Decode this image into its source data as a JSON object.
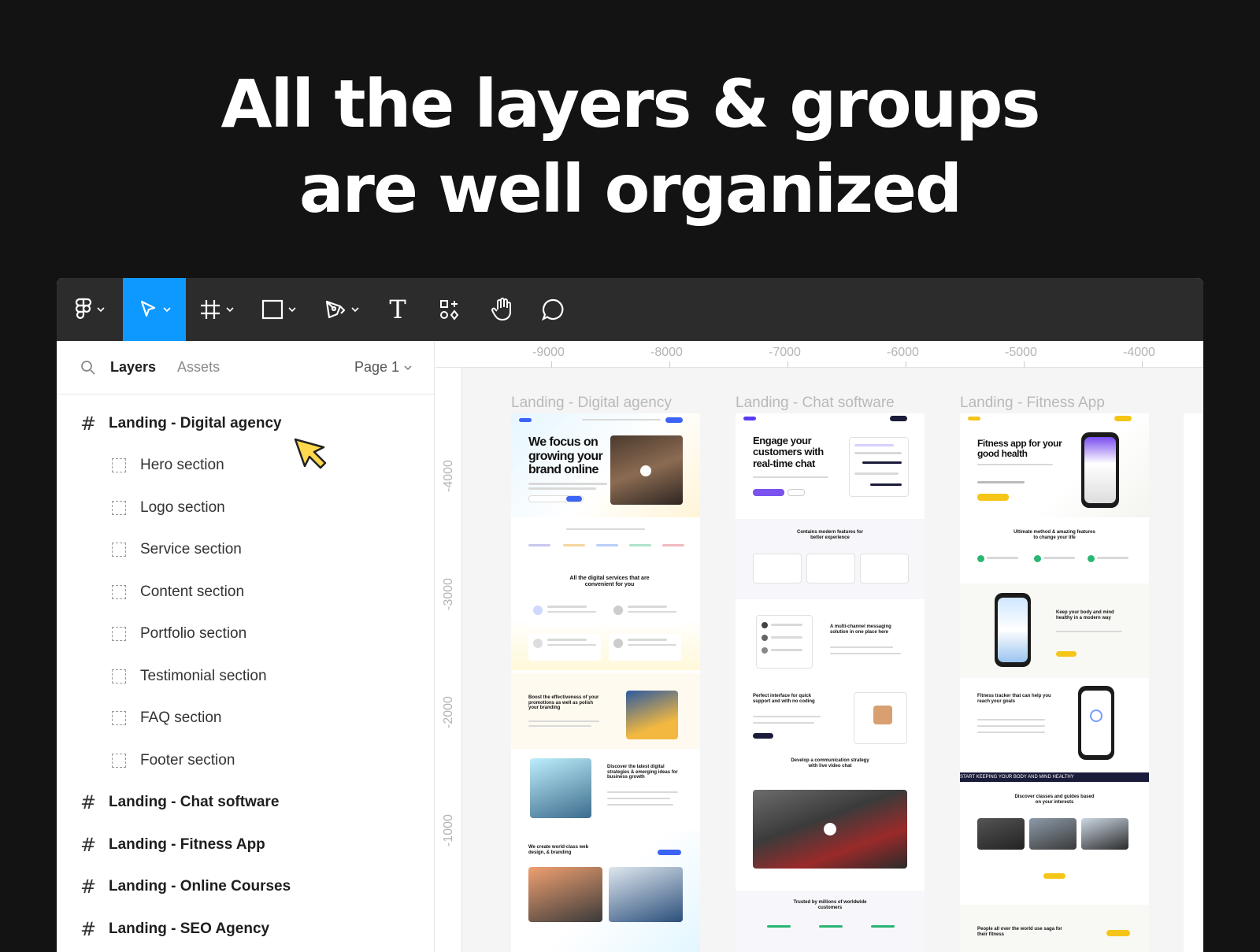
{
  "headline": {
    "line1": "All the layers & groups",
    "line2": "are well organized"
  },
  "toolbar": {
    "tools": [
      "main-menu",
      "move",
      "frame",
      "shape",
      "pen",
      "text",
      "resources",
      "hand",
      "comment"
    ],
    "text_tool_glyph": "T",
    "active": "move",
    "accent": "#0d99ff"
  },
  "panel": {
    "tab_layers": "Layers",
    "tab_assets": "Assets",
    "page_label": "Page 1"
  },
  "layers": {
    "frame1": "Landing - Digital agency",
    "children": [
      "Hero section",
      "Logo section",
      "Service section",
      "Content section",
      "Portfolio section",
      "Testimonial section",
      "FAQ section",
      "Footer section"
    ],
    "frame2": "Landing - Chat software",
    "frame3": "Landing - Fitness App",
    "frame4": "Landing - Online Courses",
    "frame5": "Landing - SEO Agency"
  },
  "rulers": {
    "top": [
      "-9000",
      "-8000",
      "-7000",
      "-6000",
      "-5000",
      "-4000"
    ],
    "left": [
      "-4000",
      "-3000",
      "-2000",
      "-1000"
    ]
  },
  "canvas": {
    "frame_titles": [
      "Landing - Digital agency",
      "Landing - Chat software",
      "Landing - Fitness App"
    ],
    "agency": {
      "hero": "We focus on growing your brand online",
      "services": "All the digital services that are convenient for you",
      "boost": "Boost the effectiveness of your promotions as well as polish your branding",
      "discover": "Discover the latest digital strategies & emerging ideas for business growth",
      "create": "We create world-class web design, & branding"
    },
    "chat": {
      "hero": "Engage your customers with real-time chat",
      "features": "Contains modern features for better experience",
      "multi": "A multi-channel messaging solution in one place here",
      "perfect": "Perfect interface for quick support and with no coding",
      "develop": "Develop a communication strategy with live video chat",
      "trusted": "Trusted by millions of worldwide customers"
    },
    "fitness": {
      "hero": "Fitness app for your good health",
      "ultimate": "Ultimate method & amazing features to change your life",
      "keep": "Keep your body and mind healthy in a modern way",
      "tracker": "Fitness tracker that can help you reach your goals",
      "banner": "START KEEPING YOUR BODY AND MIND HEALTHY",
      "classes": "Discover classes and guides based on your interests",
      "people": "People all over the world use saga for their fitness"
    }
  }
}
